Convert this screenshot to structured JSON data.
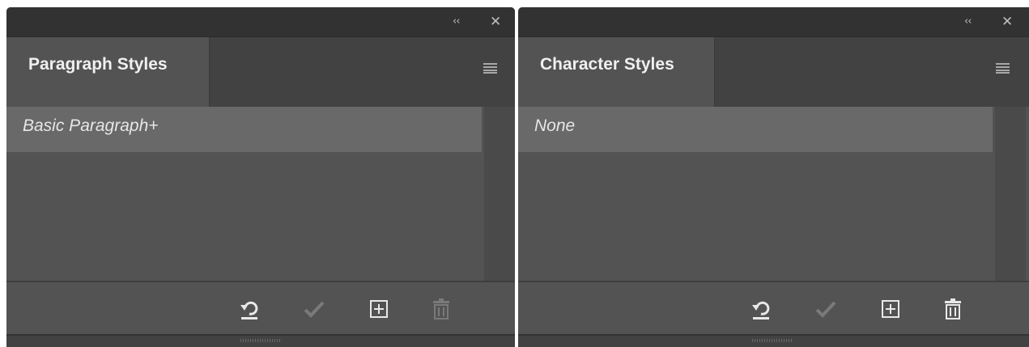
{
  "panels": [
    {
      "id": "paragraph-styles",
      "tab_label": "Paragraph Styles",
      "titlebar": {
        "collapse_glyph": "‹‹",
        "close_glyph": "✕"
      },
      "items": [
        {
          "label": "Basic Paragraph+",
          "selected": true
        }
      ],
      "footer": {
        "buttons": [
          {
            "icon": "clear-overrides-icon",
            "enabled": true
          },
          {
            "icon": "checkmark-icon",
            "enabled": false
          },
          {
            "icon": "new-style-icon",
            "enabled": true
          },
          {
            "icon": "trash-icon",
            "enabled": false
          }
        ]
      }
    },
    {
      "id": "character-styles",
      "tab_label": "Character Styles",
      "titlebar": {
        "collapse_glyph": "‹‹",
        "close_glyph": "✕"
      },
      "items": [
        {
          "label": "None",
          "selected": true
        }
      ],
      "footer": {
        "buttons": [
          {
            "icon": "clear-overrides-icon",
            "enabled": true
          },
          {
            "icon": "checkmark-icon",
            "enabled": false
          },
          {
            "icon": "new-style-icon",
            "enabled": true
          },
          {
            "icon": "trash-icon",
            "enabled": true
          }
        ]
      }
    }
  ],
  "colors": {
    "panel_bg": "#535353",
    "titlebar_bg": "#323232",
    "tabbar_bg": "#424242",
    "selected_row_bg": "#696969",
    "icon_enabled": "#e8e8e8",
    "icon_disabled": "#7a7a7a"
  }
}
